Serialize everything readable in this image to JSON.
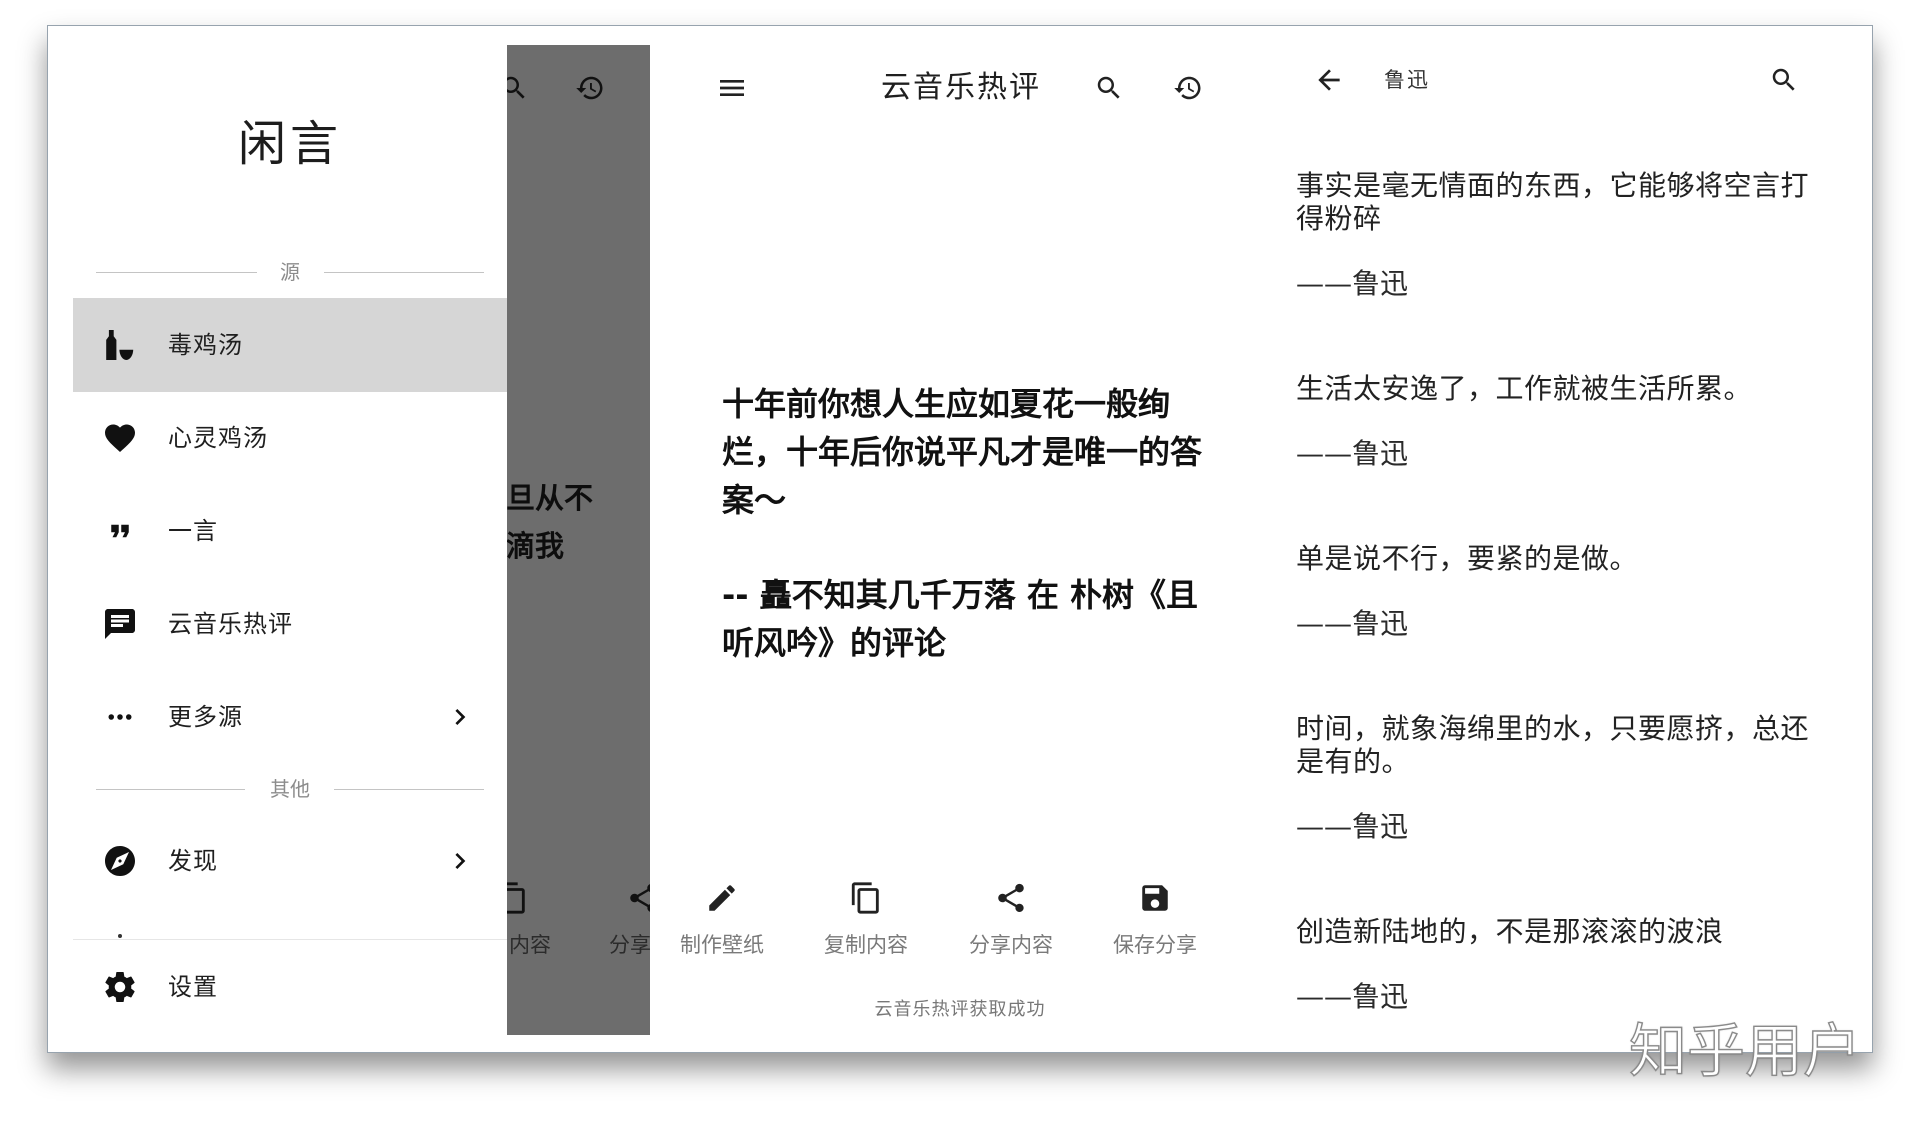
{
  "colors": {
    "scrim": "#6d6d6d",
    "selected_row": "#d6d6d6",
    "text_primary": "#1f1f1f",
    "text_secondary": "#7a7a7a",
    "divider": "#c4c4c4"
  },
  "drawer": {
    "title": "闲言",
    "section_source_label": "源",
    "source_items": [
      {
        "label": "毒鸡汤",
        "icon": "bottle-glass-icon",
        "selected": true,
        "has_chevron": false
      },
      {
        "label": "心灵鸡汤",
        "icon": "heart-icon",
        "selected": false,
        "has_chevron": false
      },
      {
        "label": "一言",
        "icon": "quote-icon",
        "selected": false,
        "has_chevron": false
      },
      {
        "label": "云音乐热评",
        "icon": "comment-icon",
        "selected": false,
        "has_chevron": false
      },
      {
        "label": "更多源",
        "icon": "more-dots-icon",
        "selected": false,
        "has_chevron": true
      }
    ],
    "section_other_label": "其他",
    "other_items": [
      {
        "label": "发现",
        "icon": "compass-icon",
        "has_chevron": true
      }
    ],
    "settings": {
      "label": "设置",
      "icon": "gear-icon"
    }
  },
  "drawer_backdrop": {
    "text_lines": [
      "旦从不",
      "滴我"
    ],
    "action_labels": [
      "内容",
      "分享"
    ],
    "icons": [
      "search-icon",
      "history-icon",
      "copy-icon",
      "share-icon"
    ]
  },
  "comment_screen": {
    "title": "云音乐热评",
    "comment": "十年前你想人生应如夏花一般绚烂，十年后你说平凡才是唯一的答案～",
    "source": "-- 矗不知其几千万落 在 朴树《且听风吟》的评论",
    "actions": [
      {
        "label": "制作壁纸",
        "icon": "edit-pencil-icon"
      },
      {
        "label": "复制内容",
        "icon": "copy-icon"
      },
      {
        "label": "分享内容",
        "icon": "share-icon"
      },
      {
        "label": "保存分享",
        "icon": "save-icon"
      }
    ],
    "toast": "云音乐热评获取成功"
  },
  "author_screen": {
    "title": "鲁迅",
    "quotes": [
      {
        "text": "事实是毫无情面的东西，它能够将空言打得粉碎",
        "author": "——鲁迅"
      },
      {
        "text": "生活太安逸了，工作就被生活所累。",
        "author": "——鲁迅"
      },
      {
        "text": "单是说不行，要紧的是做。",
        "author": "——鲁迅"
      },
      {
        "text": "时间，就象海绵里的水，只要愿挤，总还是有的。",
        "author": "——鲁迅"
      },
      {
        "text": "创造新陆地的，不是那滚滚的波浪",
        "author": "——鲁迅"
      }
    ]
  },
  "watermark": "知乎用户"
}
